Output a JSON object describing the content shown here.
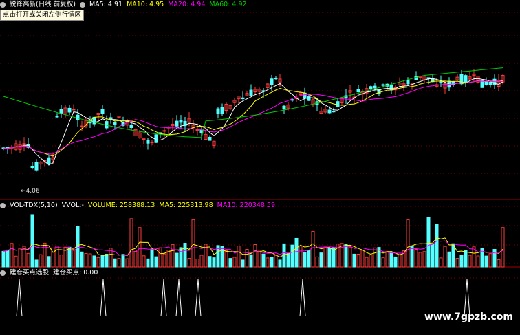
{
  "main_header": {
    "title": "锐锋高新(日线 前复权)",
    "ma5": "MA5: 4.91",
    "ma10": "MA10: 4.95",
    "ma20": "MA20: 4.94",
    "ma60": "MA60: 4.92"
  },
  "tooltip": "点击打开或关闭左侧行情区",
  "low_label": "←4.06",
  "vol_header": {
    "name": "VOL-TDX(5,10)",
    "mode": "VVOL:-",
    "volume": "VOLUME: 258388.13",
    "ma5": "MA5: 225313.98",
    "ma10": "MA10: 220348.59"
  },
  "ind_header": {
    "name": "建仓买点选股",
    "value": "建仓买点: 0.00"
  },
  "watermark": "www.7gpzb.com",
  "colors": {
    "up": "#ff3b3b",
    "down": "#54ffff",
    "ma5": "#ffffff",
    "ma10": "#ffff00",
    "ma20": "#ff00ff",
    "ma60": "#00cc00",
    "grid": "#7a0000"
  }
}
